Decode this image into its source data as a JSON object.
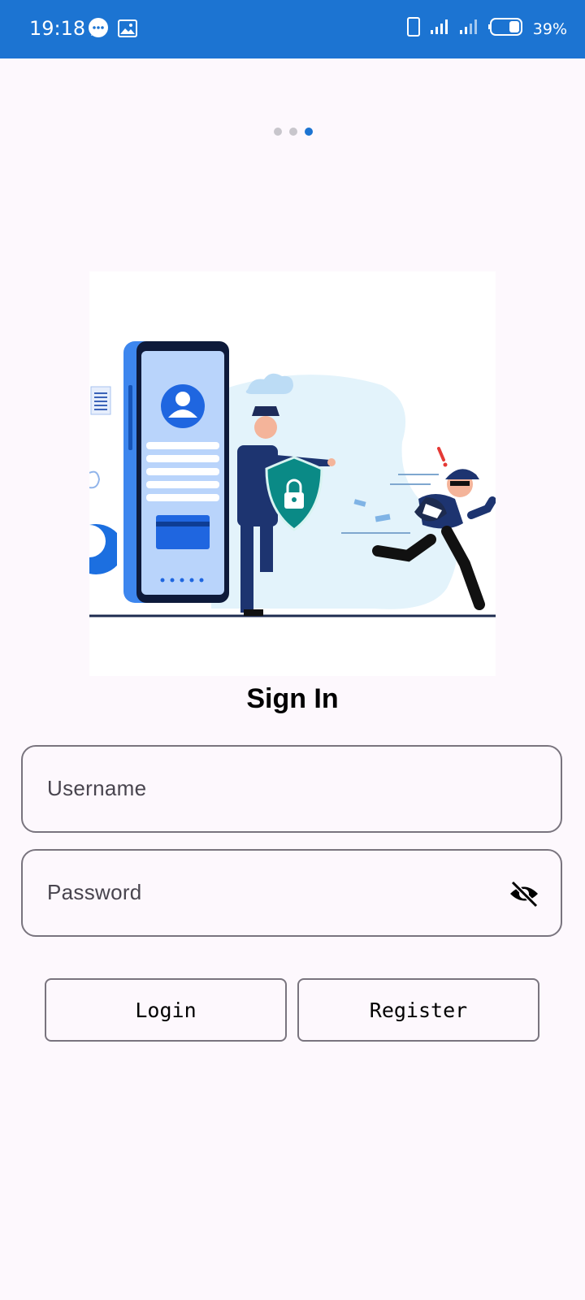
{
  "status_bar": {
    "time": "19:18",
    "battery": "39%",
    "icons": [
      "message-icon",
      "image-icon",
      "vibrate-icon",
      "signal-icon",
      "signal-icon-2",
      "battery-icon"
    ]
  },
  "pager": {
    "total": 3,
    "active": 3
  },
  "illustration": {
    "name": "security-illustration"
  },
  "form": {
    "title": "Sign In",
    "username_placeholder": "Username",
    "password_placeholder": "Password",
    "password_toggle_icon": "eye-off-icon"
  },
  "buttons": {
    "login": "Login",
    "register": "Register"
  },
  "colors": {
    "status_bar": "#1c74d2",
    "background": "#fdf8fd",
    "accent": "#1c74d2",
    "outline": "#79747e"
  }
}
